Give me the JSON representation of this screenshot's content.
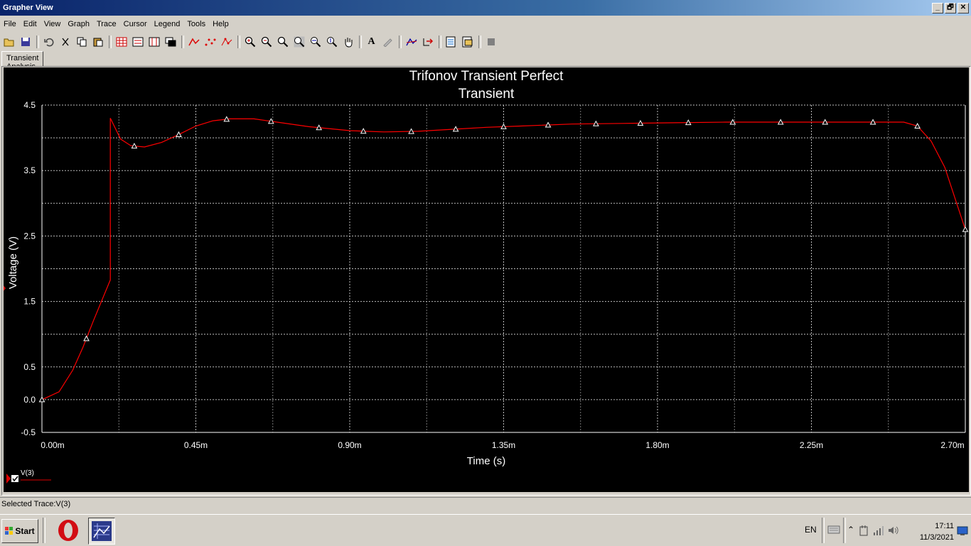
{
  "window": {
    "title": "Grapher View",
    "buttons": [
      "_",
      "🗗",
      "✕"
    ]
  },
  "menu": [
    "File",
    "Edit",
    "View",
    "Graph",
    "Trace",
    "Cursor",
    "Legend",
    "Tools",
    "Help"
  ],
  "toolbar_icons": [
    "open-icon",
    "save-icon",
    "undo-icon",
    "cut-icon",
    "copy-icon",
    "paste-icon",
    "grid-icon",
    "legend-icon",
    "cursor-icon",
    "overlay-icon",
    "line-trace-icon",
    "dot-trace-icon",
    "line-dot-trace-icon",
    "zoom-in-icon",
    "zoom-out-icon",
    "zoom-area-icon",
    "zoom-full-icon",
    "zoom-x-icon",
    "zoom-y-icon",
    "pan-icon",
    "text-icon",
    "pen-icon",
    "trace-props-icon",
    "export-icon",
    "page-setup-icon",
    "print-icon",
    "stop-icon"
  ],
  "tab": {
    "label": "Transient Analysis"
  },
  "chart_data": {
    "type": "line",
    "title": "Trifonov Transient Perfect",
    "subtitle": "Transient",
    "xlabel": "Time (s)",
    "ylabel": "Voltage (V)",
    "xlim": [
      0,
      2.7
    ],
    "ylim": [
      -0.5,
      4.5
    ],
    "x_ticks": [
      "0.00m",
      "0.45m",
      "0.90m",
      "1.35m",
      "1.80m",
      "2.25m",
      "2.70m"
    ],
    "x_tick_values": [
      0,
      0.45,
      0.9,
      1.35,
      1.8,
      2.25,
      2.7
    ],
    "y_ticks": [
      "4.5",
      "3.5",
      "2.5",
      "1.5",
      "0.5",
      "0.0",
      "-0.5"
    ],
    "y_tick_values": [
      4.5,
      3.5,
      2.5,
      1.5,
      0.5,
      0.0,
      -0.5
    ],
    "grid": true,
    "legend": "bottom-left",
    "series": [
      {
        "name": "V(3)",
        "color": "#ff0000",
        "x": [
          0.0,
          0.05,
          0.09,
          0.12,
          0.15,
          0.2,
          0.2,
          0.23,
          0.26,
          0.3,
          0.35,
          0.4,
          0.45,
          0.5,
          0.55,
          0.62,
          0.7,
          0.78,
          0.9,
          1.0,
          1.1,
          1.2,
          1.3,
          1.4,
          1.55,
          1.7,
          1.85,
          2.0,
          2.2,
          2.4,
          2.52,
          2.56,
          2.6,
          2.64,
          2.7
        ],
        "y": [
          0.0,
          0.12,
          0.45,
          0.8,
          1.2,
          1.83,
          4.3,
          3.98,
          3.88,
          3.86,
          3.93,
          4.05,
          4.18,
          4.26,
          4.29,
          4.29,
          4.23,
          4.17,
          4.11,
          4.09,
          4.1,
          4.13,
          4.16,
          4.18,
          4.21,
          4.22,
          4.23,
          4.24,
          4.24,
          4.24,
          4.24,
          4.18,
          3.95,
          3.55,
          2.6
        ]
      }
    ],
    "markers_x": [
      0.0,
      0.13,
      0.27,
      0.4,
      0.54,
      0.67,
      0.81,
      0.94,
      1.08,
      1.21,
      1.35,
      1.48,
      1.62,
      1.75,
      1.89,
      2.02,
      2.16,
      2.29,
      2.43,
      2.56,
      2.7
    ]
  },
  "status": {
    "selected_trace": "Selected Trace:V(3)"
  },
  "taskbar": {
    "start": "Start",
    "lang": "EN",
    "time": "17:11",
    "date": "11/3/2021"
  }
}
